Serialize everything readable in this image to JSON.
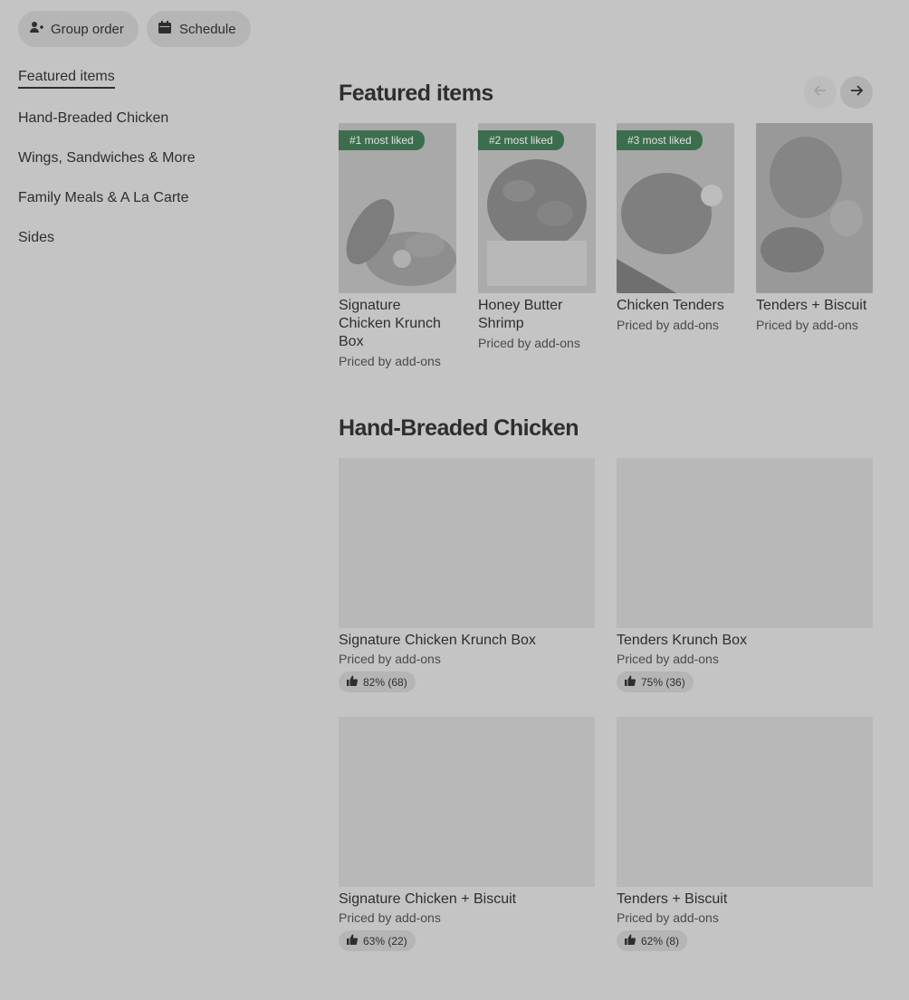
{
  "top_actions": {
    "group_order": "Group order",
    "schedule": "Schedule"
  },
  "sidebar": {
    "items": [
      {
        "label": "Featured items",
        "active": true
      },
      {
        "label": "Hand-Breaded Chicken"
      },
      {
        "label": "Wings, Sandwiches & More"
      },
      {
        "label": "Family Meals & A La Carte"
      },
      {
        "label": "Sides"
      }
    ]
  },
  "featured": {
    "title": "Featured items",
    "items": [
      {
        "badge": "#1 most liked",
        "name": "Signature Chicken Krunch Box",
        "price": "Priced by add-ons"
      },
      {
        "badge": "#2 most liked",
        "name": "Honey Butter Shrimp",
        "price": "Priced by add-ons"
      },
      {
        "badge": "#3 most liked",
        "name": "Chicken Tenders",
        "price": "Priced by add-ons"
      },
      {
        "name": "Tenders + Biscuit",
        "price": "Priced by add-ons"
      }
    ]
  },
  "hand_breaded": {
    "title": "Hand-Breaded Chicken",
    "items": [
      {
        "name": "Signature Chicken Krunch Box",
        "price": "Priced by add-ons",
        "rating": "82% (68)"
      },
      {
        "name": "Tenders Krunch Box",
        "price": "Priced by add-ons",
        "rating": "75% (36)"
      },
      {
        "name": "Signature Chicken + Biscuit",
        "price": "Priced by add-ons",
        "rating": "63% (22)"
      },
      {
        "name": "Tenders + Biscuit",
        "price": "Priced by add-ons",
        "rating": "62% (8)"
      }
    ]
  },
  "colors": {
    "overlay_bg": "#c4c4c4",
    "badge_green": "#3c6e4e",
    "text": "#2e2e2e"
  },
  "icons": {
    "group_order": "add-person-icon",
    "schedule": "calendar-icon",
    "prev": "arrow-left-icon",
    "next": "arrow-right-icon",
    "rating": "thumbs-up-icon"
  }
}
